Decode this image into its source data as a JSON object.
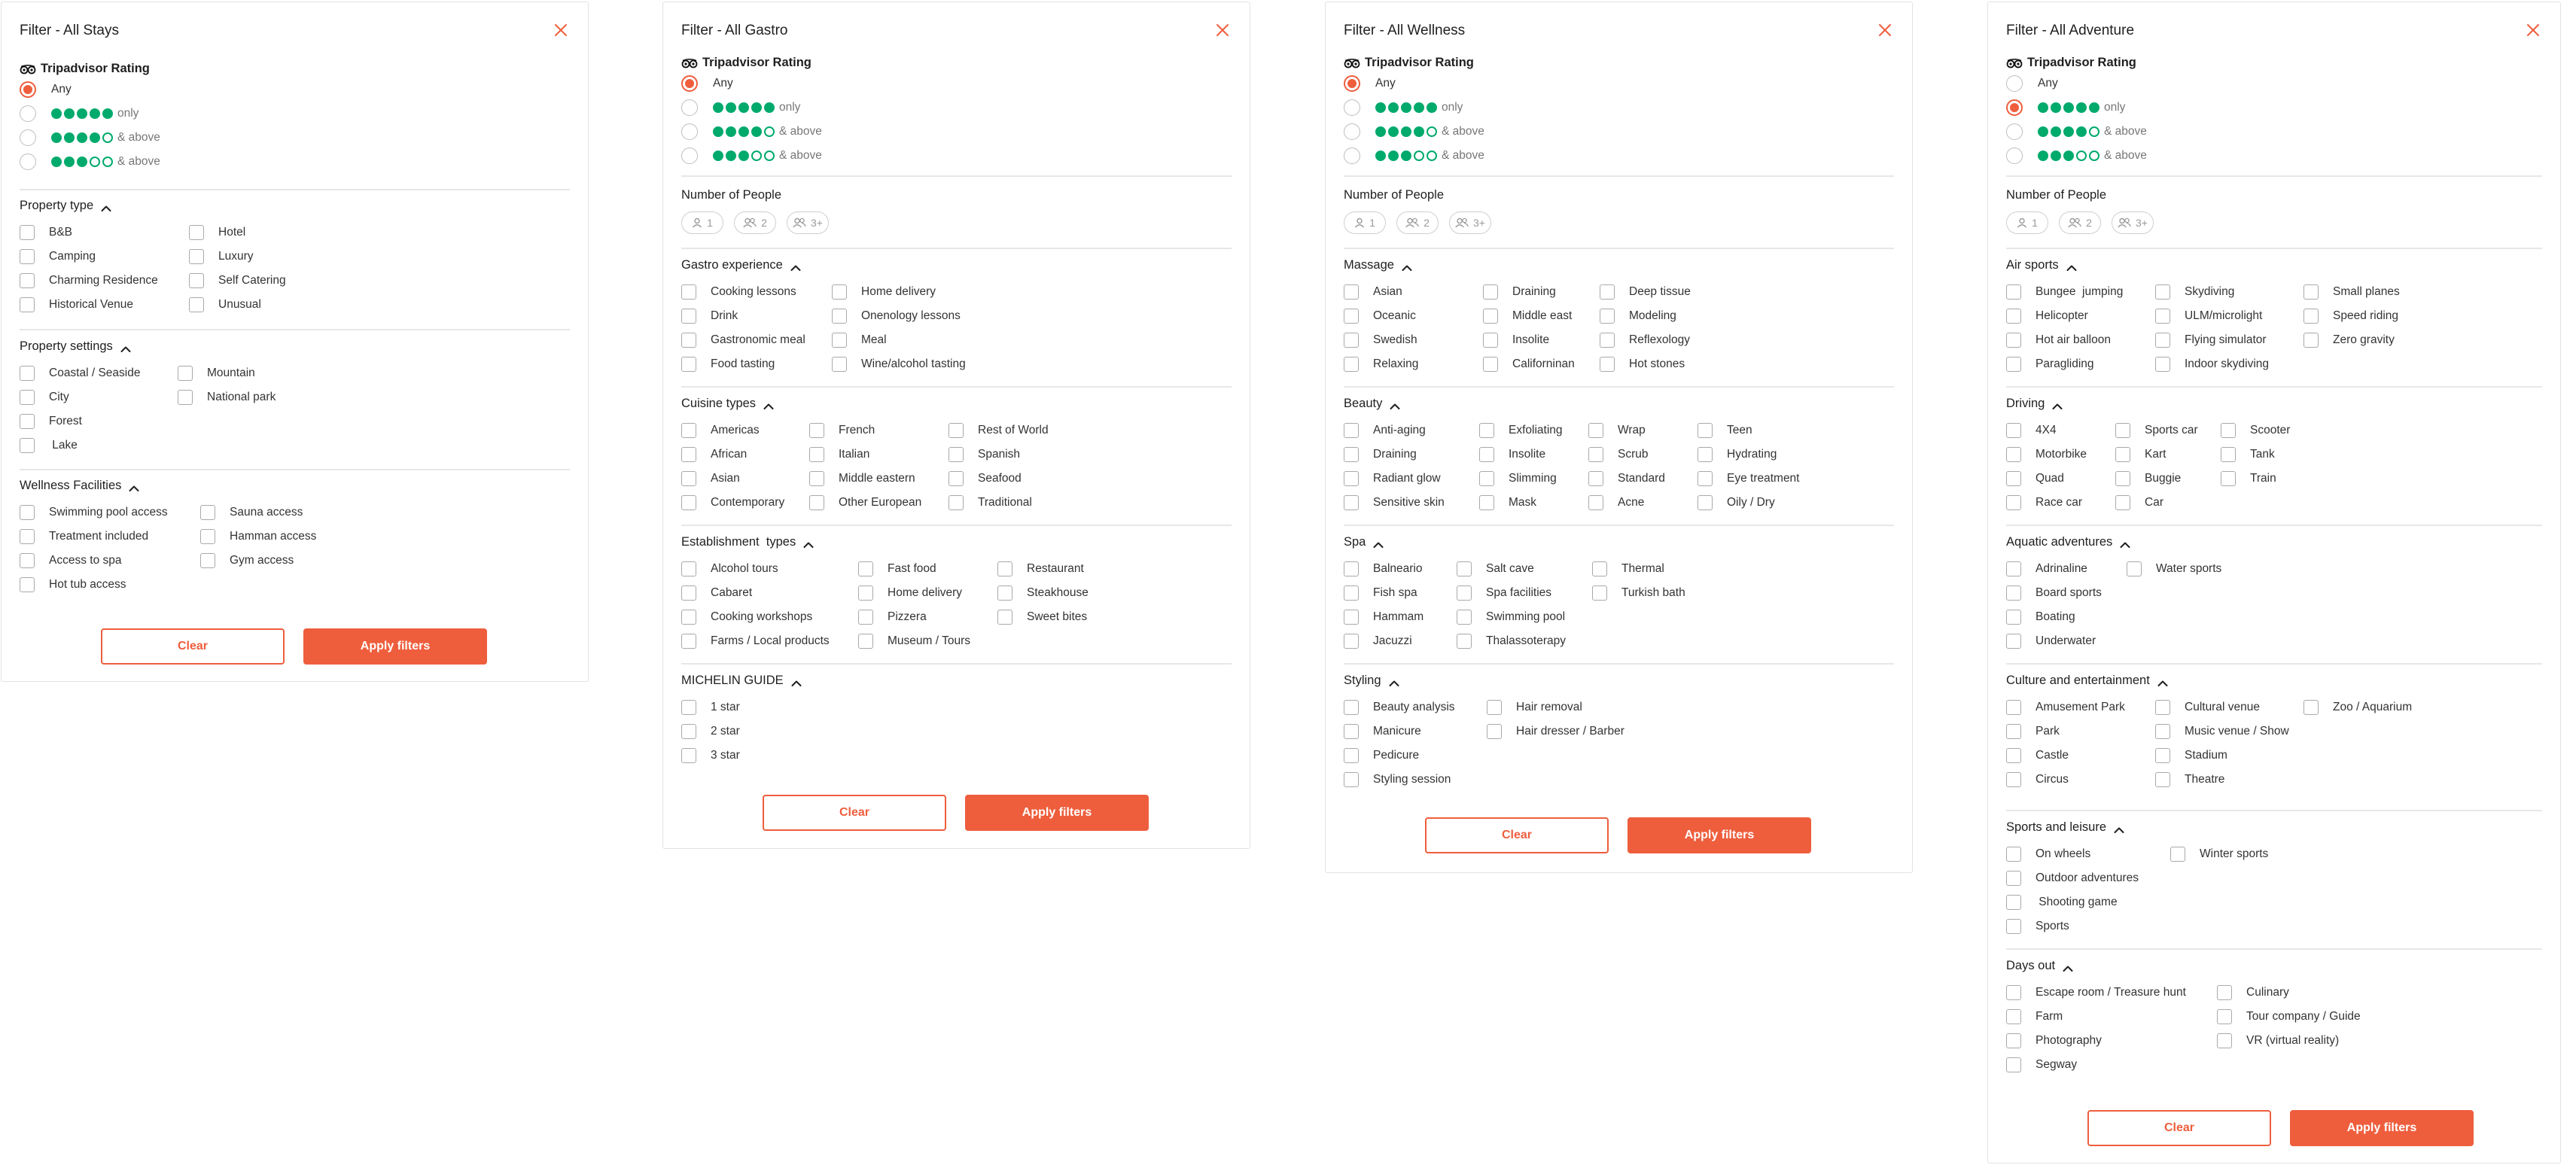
{
  "accent_color": "#ee5e3d",
  "rating_color": "#00aa6c",
  "rating_title": "Tripadvisor Rating",
  "rating_options": [
    {
      "text": "Any",
      "filled": null
    },
    {
      "text": "only",
      "filled": 5
    },
    {
      "text": "& above",
      "filled": 4
    },
    {
      "text": "& above",
      "filled": 3
    }
  ],
  "people_title": "Number of People",
  "people_options": [
    "1",
    "2",
    "3+"
  ],
  "clear_label": "Clear",
  "apply_label": "Apply filters",
  "panels": [
    {
      "title": "Filter - All Stays",
      "rating_selected": 0,
      "sections": [
        {
          "title": "Property type",
          "columns": [
            [
              "B&B",
              "Camping",
              "Charming Residence",
              "Historical Venue"
            ],
            [
              "Hotel",
              "Luxury",
              "Self Catering",
              "Unusual"
            ]
          ]
        },
        {
          "title": "Property settings",
          "columns": [
            [
              "Coastal / Seaside",
              "City",
              "Forest",
              " Lake"
            ],
            [
              "Mountain",
              "National park"
            ]
          ]
        },
        {
          "title": "Wellness Facilities",
          "columns": [
            [
              "Swimming pool access",
              "Treatment included",
              "Access to spa",
              "Hot tub access"
            ],
            [
              "Sauna access",
              "Hamman access",
              "Gym access"
            ]
          ]
        }
      ]
    },
    {
      "title": "Filter - All Gastro",
      "rating_selected": 0,
      "sections": [
        {
          "title": "Gastro experience",
          "columns": [
            [
              "Cooking lessons",
              "Drink",
              "Gastronomic meal",
              "Food tasting"
            ],
            [
              "Home delivery",
              "Onenology lessons",
              "Meal",
              "Wine/alcohol tasting"
            ]
          ]
        },
        {
          "title": "Cuisine types",
          "columns": [
            [
              "Americas",
              "African",
              "Asian",
              "Contemporary"
            ],
            [
              "French",
              "Italian",
              "Middle eastern",
              "Other European"
            ],
            [
              "Rest of World",
              "Spanish",
              "Seafood",
              "Traditional"
            ]
          ]
        },
        {
          "title": "Establishment  types",
          "columns": [
            [
              "Alcohol tours",
              "Cabaret",
              "Cooking workshops",
              "Farms / Local products"
            ],
            [
              "Fast food",
              "Home delivery",
              "Pizzera",
              "Museum / Tours"
            ],
            [
              "Restaurant",
              "Steakhouse",
              "Sweet bites"
            ]
          ]
        },
        {
          "title": "MICHELIN GUIDE",
          "columns": [
            [
              "1 star",
              "2 star",
              "3 star"
            ]
          ]
        }
      ]
    },
    {
      "title": "Filter - All Wellness",
      "rating_selected": 0,
      "sections": [
        {
          "title": "Massage",
          "columns": [
            [
              "Asian",
              "Oceanic",
              "Swedish",
              "Relaxing"
            ],
            [
              "Draining",
              "Middle east",
              "Insolite",
              "Californinan"
            ],
            [
              "Deep tissue",
              "Modeling",
              "Reflexology",
              "Hot stones"
            ]
          ]
        },
        {
          "title": "Beauty",
          "columns": [
            [
              "Anti-aging",
              "Draining",
              "Radiant glow",
              "Sensitive skin"
            ],
            [
              "Exfoliating",
              "Insolite",
              "Slimming",
              "Mask"
            ],
            [
              "Wrap",
              "Scrub",
              "Standard",
              "Acne"
            ],
            [
              "Teen",
              "Hydrating",
              "Eye treatment",
              "Oily / Dry"
            ]
          ]
        },
        {
          "title": "Spa",
          "columns": [
            [
              "Balneario",
              "Fish spa",
              "Hammam",
              "Jacuzzi"
            ],
            [
              "Salt cave",
              "Spa facilities",
              "Swimming pool",
              "Thalassoterapy"
            ],
            [
              "Thermal",
              "Turkish bath"
            ]
          ]
        },
        {
          "title": "Styling",
          "columns": [
            [
              "Beauty analysis",
              "Manicure",
              "Pedicure",
              "Styling session"
            ],
            [
              "Hair removal",
              "Hair dresser / Barber"
            ]
          ]
        }
      ]
    },
    {
      "title": "Filter - All Adventure",
      "rating_selected": 1,
      "sections": [
        {
          "title": "Air sports",
          "columns": [
            [
              "Bungee  jumping",
              "Helicopter",
              "Hot air balloon",
              "Paragliding"
            ],
            [
              "Skydiving",
              "ULM/microlight",
              "Flying simulator",
              "Indoor skydiving"
            ],
            [
              "Small planes",
              "Speed riding",
              "Zero gravity"
            ]
          ]
        },
        {
          "title": "Driving",
          "columns": [
            [
              "4X4",
              "Motorbike",
              "Quad",
              "Race car"
            ],
            [
              "Sports car",
              "Kart",
              "Buggie",
              "Car"
            ],
            [
              "Scooter",
              "Tank",
              "Train"
            ]
          ]
        },
        {
          "title": "Aquatic adventures",
          "columns": [
            [
              "Adrinaline",
              "Board sports",
              "Boating",
              "Underwater"
            ],
            [
              "Water sports"
            ]
          ]
        },
        {
          "title": "Culture and entertainment",
          "columns": [
            [
              "Amusement Park",
              "Park",
              "Castle",
              "Circus"
            ],
            [
              "Cultural venue",
              "Music venue / Show",
              "Stadium",
              "Theatre"
            ],
            [
              "Zoo / Aquarium"
            ]
          ]
        },
        {
          "title": "Sports and leisure",
          "columns": [
            [
              "On wheels",
              "Outdoor adventures",
              " Shooting game",
              "Sports"
            ],
            [
              "Winter sports"
            ]
          ]
        },
        {
          "title": "Days out",
          "columns": [
            [
              "Escape room / Treasure hunt",
              "Farm",
              "Photography",
              "Segway"
            ],
            [
              "Culinary",
              "Tour company / Guide",
              "VR (virtual reality)"
            ]
          ]
        }
      ]
    }
  ]
}
